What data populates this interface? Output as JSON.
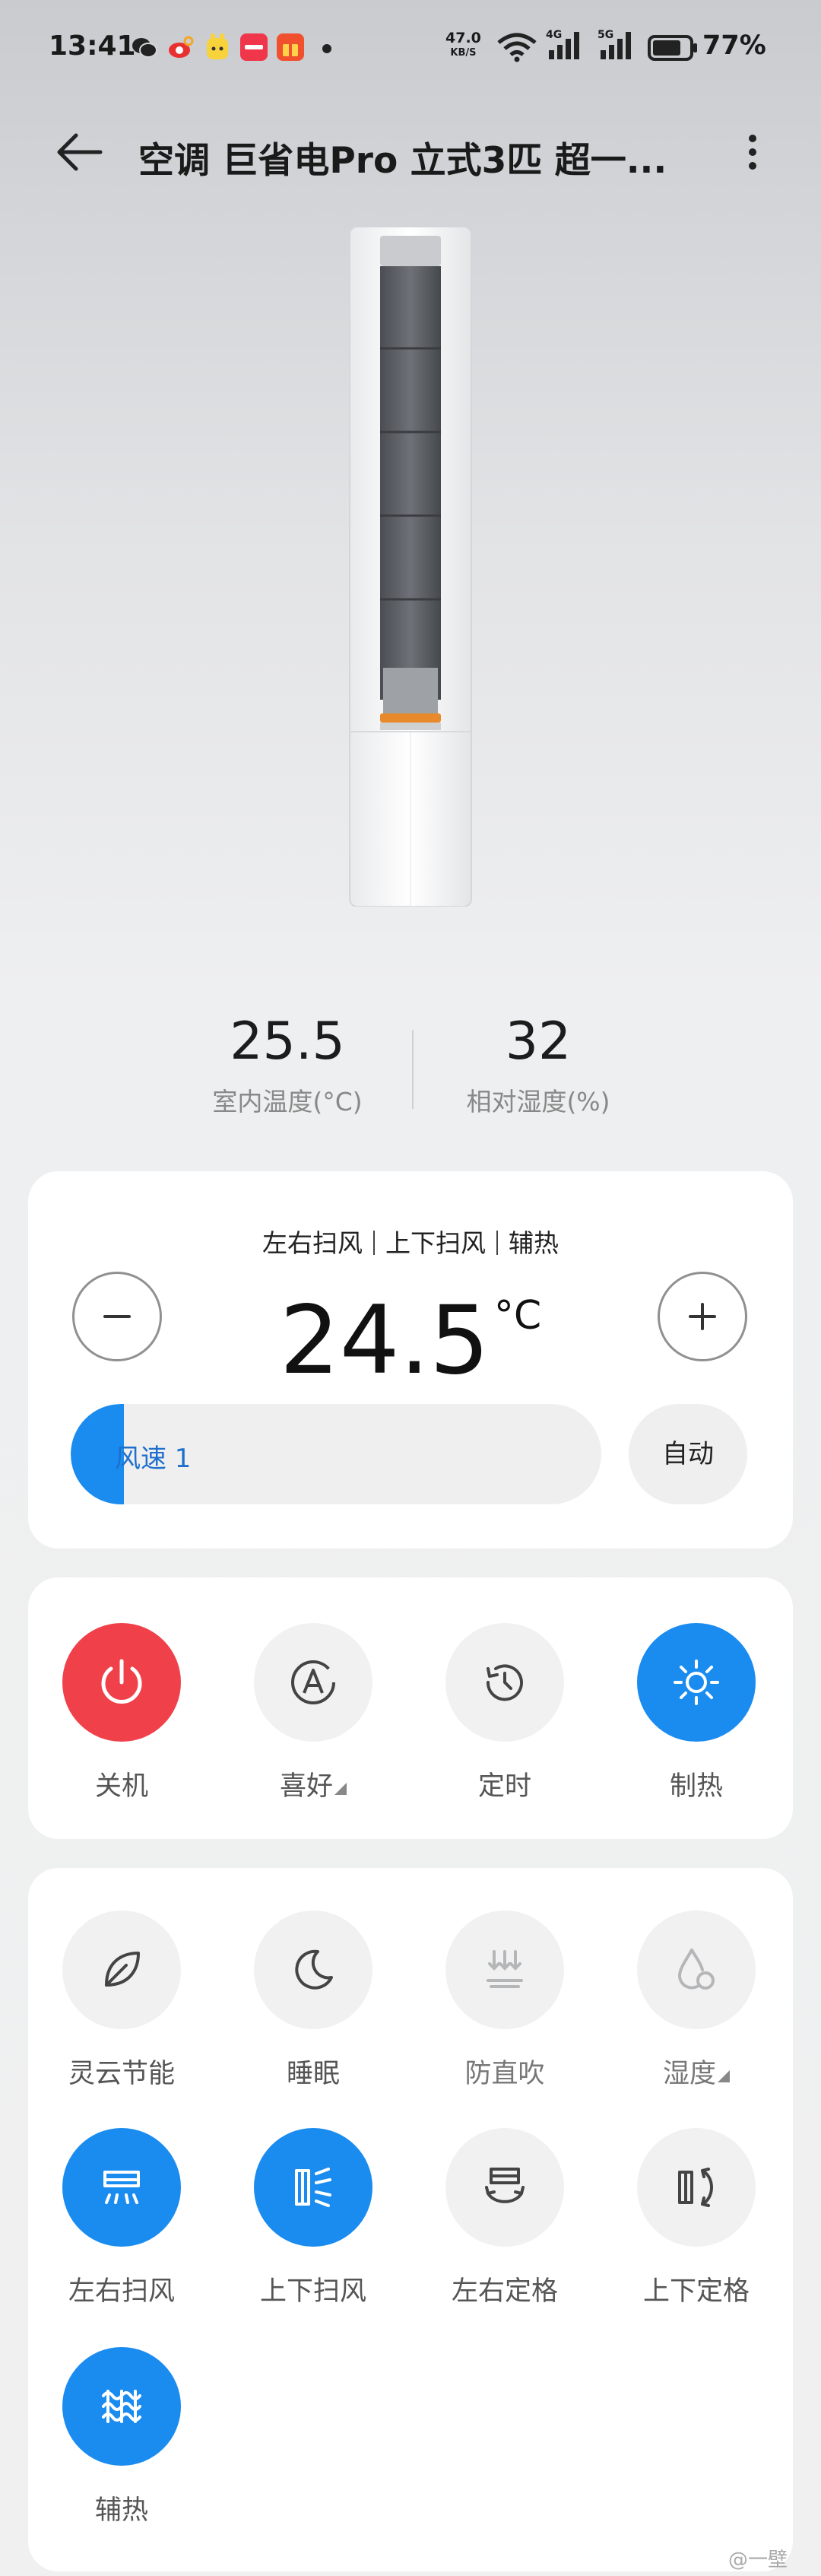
{
  "status_bar": {
    "time": "13:41",
    "net_speed": "47.0",
    "net_speed_unit": "KB/S",
    "sim1_label": "4G",
    "sim2_label": "5G",
    "battery": "77%",
    "battery_level": 0.77
  },
  "header": {
    "title": "空调 巨省电Pro 立式3匹 超一..."
  },
  "readings": {
    "indoor_temp": "25.5",
    "indoor_temp_label": "室内温度(°C)",
    "humidity": "32",
    "humidity_label": "相对湿度(%)"
  },
  "control": {
    "mode_tags": [
      "左右扫风",
      "上下扫风",
      "辅热"
    ],
    "target_temp": "24.5",
    "temp_unit": "°C",
    "fan_label": "风速 1",
    "fan_level": 0.1,
    "auto_label": "自动"
  },
  "main_functions": [
    {
      "label": "关机",
      "icon": "power-icon",
      "state": "red"
    },
    {
      "label": "喜好",
      "icon": "preference-icon",
      "state": "off",
      "has_menu": true
    },
    {
      "label": "定时",
      "icon": "timer-icon",
      "state": "off"
    },
    {
      "label": "制热",
      "icon": "sun-icon",
      "state": "blue"
    }
  ],
  "extra_functions": [
    {
      "label": "灵云节能",
      "icon": "leaf-icon",
      "state": "off"
    },
    {
      "label": "睡眠",
      "icon": "moon-icon",
      "state": "off"
    },
    {
      "label": "防直吹",
      "icon": "anti-direct-wind-icon",
      "state": "disabled"
    },
    {
      "label": "湿度",
      "icon": "humidity-icon",
      "state": "disabled",
      "has_menu": true
    },
    {
      "label": "左右扫风",
      "icon": "horizontal-swing-icon",
      "state": "blue"
    },
    {
      "label": "上下扫风",
      "icon": "vertical-swing-icon",
      "state": "blue"
    },
    {
      "label": "左右定格",
      "icon": "horizontal-fix-icon",
      "state": "off"
    },
    {
      "label": "上下定格",
      "icon": "vertical-fix-icon",
      "state": "off"
    },
    {
      "label": "辅热",
      "icon": "aux-heat-icon",
      "state": "blue"
    }
  ],
  "colors": {
    "accent_blue": "#1a8cf0",
    "power_red": "#f0414a",
    "tile_off": "#f1f1f2"
  },
  "watermark": "@一壁"
}
